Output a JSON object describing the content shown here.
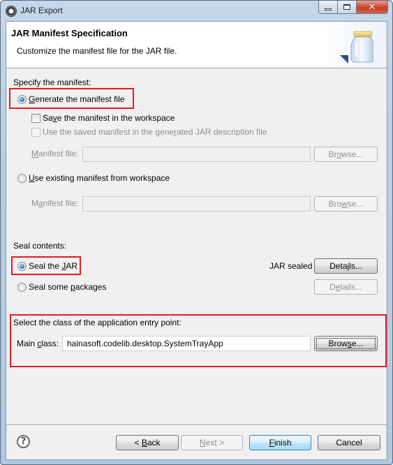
{
  "window": {
    "title": "JAR Export",
    "controls": {
      "minimize": "minimize",
      "maximize": "maximize",
      "close": "✕"
    }
  },
  "banner": {
    "title": "JAR Manifest Specification",
    "description": "Customize the manifest file for the JAR file."
  },
  "manifest": {
    "section_label": "Specify the manifest:",
    "generate": {
      "mnemonic": "G",
      "rest": "enerate the manifest file",
      "checked": true
    },
    "save_in_workspace": {
      "pre": "Sa",
      "mnemonic": "v",
      "rest": "e the manifest in the workspace",
      "checked": false
    },
    "use_saved": {
      "pre": "Use the saved manifest in the gene",
      "mnemonic": "r",
      "rest": "ated JAR description file",
      "checked": false,
      "enabled": false
    },
    "manifest_file_1": {
      "mnemonic": "M",
      "rest": "anifest file:",
      "value": "",
      "browse_pre": "Br",
      "browse_mnemonic": "o",
      "browse_rest": "wse..."
    },
    "use_existing": {
      "mnemonic": "U",
      "rest": "se existing manifest from workspace",
      "checked": false
    },
    "manifest_file_2": {
      "pre": "M",
      "mnemonic": "a",
      "rest": "nifest file:",
      "value": "",
      "browse_pre": "Bro",
      "browse_mnemonic": "w",
      "browse_rest": "se..."
    }
  },
  "seal": {
    "section_label": "Seal contents:",
    "seal_jar": {
      "pre": "Seal the ",
      "mnemonic": "J",
      "rest": "AR",
      "checked": true
    },
    "seal_status": "JAR sealed",
    "details_1": {
      "pre": "Deta",
      "mnemonic": "i",
      "rest": "ls..."
    },
    "seal_packages": {
      "pre": "Seal some ",
      "mnemonic": "p",
      "rest": "ackages",
      "checked": false
    },
    "details_2": {
      "pre": "D",
      "mnemonic": "e",
      "rest": "tails..."
    }
  },
  "entry_point": {
    "section_label": "Select the class of the application entry point:",
    "main_class": {
      "pre": "Main ",
      "mnemonic": "c",
      "rest": "lass:",
      "value": "hainasoft.codelib.desktop.SystemTrayApp"
    },
    "browse": {
      "pre": "Brow",
      "mnemonic": "s",
      "rest": "e..."
    }
  },
  "footer": {
    "help": "?",
    "back": {
      "pre": "< ",
      "mnemonic": "B",
      "rest": "ack"
    },
    "next": {
      "mnemonic": "N",
      "rest": "ext >"
    },
    "finish": {
      "mnemonic": "F",
      "rest": "inish"
    },
    "cancel": "Cancel"
  },
  "colors": {
    "highlight_box": "#e21c24",
    "default_button": "#3c7fb1",
    "disabled_text": "#8d8d8d"
  }
}
